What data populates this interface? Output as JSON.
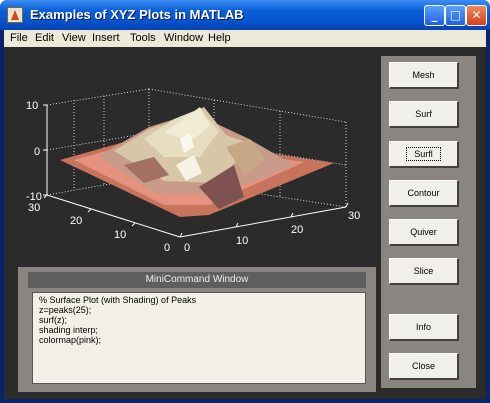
{
  "window": {
    "title": "Examples of XYZ Plots in MATLAB"
  },
  "menu": [
    "File",
    "Edit",
    "View",
    "Insert",
    "Tools",
    "Window",
    "Help"
  ],
  "plot": {
    "z_ticks": [
      "10",
      "0",
      "-10"
    ],
    "y_ticks": [
      "30",
      "20",
      "10",
      "0"
    ],
    "x_ticks": [
      "0",
      "10",
      "20",
      "30"
    ]
  },
  "command_window": {
    "title": "MiniCommand Window",
    "lines": [
      "% Surface Plot (with Shading) of Peaks",
      "z=peaks(25);",
      "surf(z);",
      "shading interp;",
      "colormap(pink);"
    ]
  },
  "buttons": [
    "Mesh",
    "Surf",
    "Surfl",
    "Contour",
    "Quiver",
    "Slice",
    "Info",
    "Close"
  ]
}
